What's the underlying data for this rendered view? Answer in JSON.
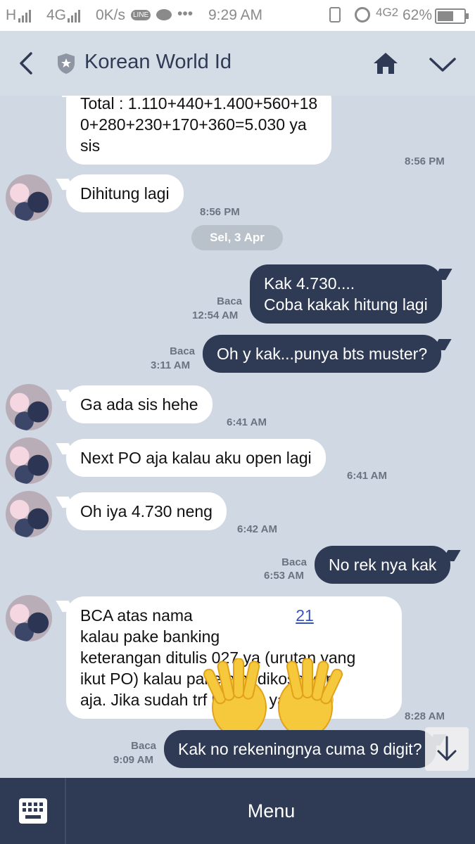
{
  "status_bar": {
    "carrier_h": "H",
    "network_4g": "4G",
    "speed": "0K/s",
    "line_badge": "LINE",
    "more": "•••",
    "time": "9:29 AM",
    "network_4g2": "4G2",
    "battery": "62%",
    "battery_level": 0.62
  },
  "header": {
    "title": "Korean World Id"
  },
  "chat": {
    "date_divider": "Sel, 3 Apr",
    "messages": [
      {
        "from": "them",
        "lines": [
          "Total : 1.110+440+1.400+560+18",
          "0+280+230+170+360=5.030 ya",
          "sis"
        ],
        "time": "8:56 PM"
      },
      {
        "from": "them",
        "text": "Dihitung lagi",
        "time": "8:56 PM"
      },
      {
        "from": "me",
        "lines": [
          "Kak 4.730....",
          "Coba kakak hitung lagi"
        ],
        "read": "Baca",
        "time": "12:54 AM"
      },
      {
        "from": "me",
        "text": "Oh y kak...punya bts muster?",
        "read": "Baca",
        "time": "3:11 AM"
      },
      {
        "from": "them",
        "text": "Ga ada sis hehe",
        "time": "6:41 AM"
      },
      {
        "from": "them",
        "text": "Next PO aja kalau aku open lagi",
        "time": "6:41 AM"
      },
      {
        "from": "them",
        "text": "Oh iya 4.730 neng",
        "time": "6:42 AM"
      },
      {
        "from": "me",
        "text": "No rek nya kak",
        "read": "Baca",
        "time": "6:53 AM"
      },
      {
        "from": "them",
        "lines": [
          "BCA atas nama ",
          "kalau pake banking",
          "keterangan ditulis 027 ya (urutan yang",
          "ikut PO) kalau pake atm dikosongin",
          "aja. Jika sudah trf kabarin ya sis "
        ],
        "link_fragment": "21",
        "emoji": "smiling-face",
        "time": "8:28 AM"
      },
      {
        "from": "me",
        "text": "Kak no rekeningnya cuma 9 digit?",
        "read": "Baca",
        "time": "9:09 AM"
      }
    ]
  },
  "bottom_bar": {
    "menu_label": "Menu"
  },
  "colors": {
    "chat_bg": "#cfd8e3",
    "outgoing_bubble": "#2f3b55",
    "incoming_bubble": "#ffffff",
    "header_text": "#2f3b55"
  }
}
